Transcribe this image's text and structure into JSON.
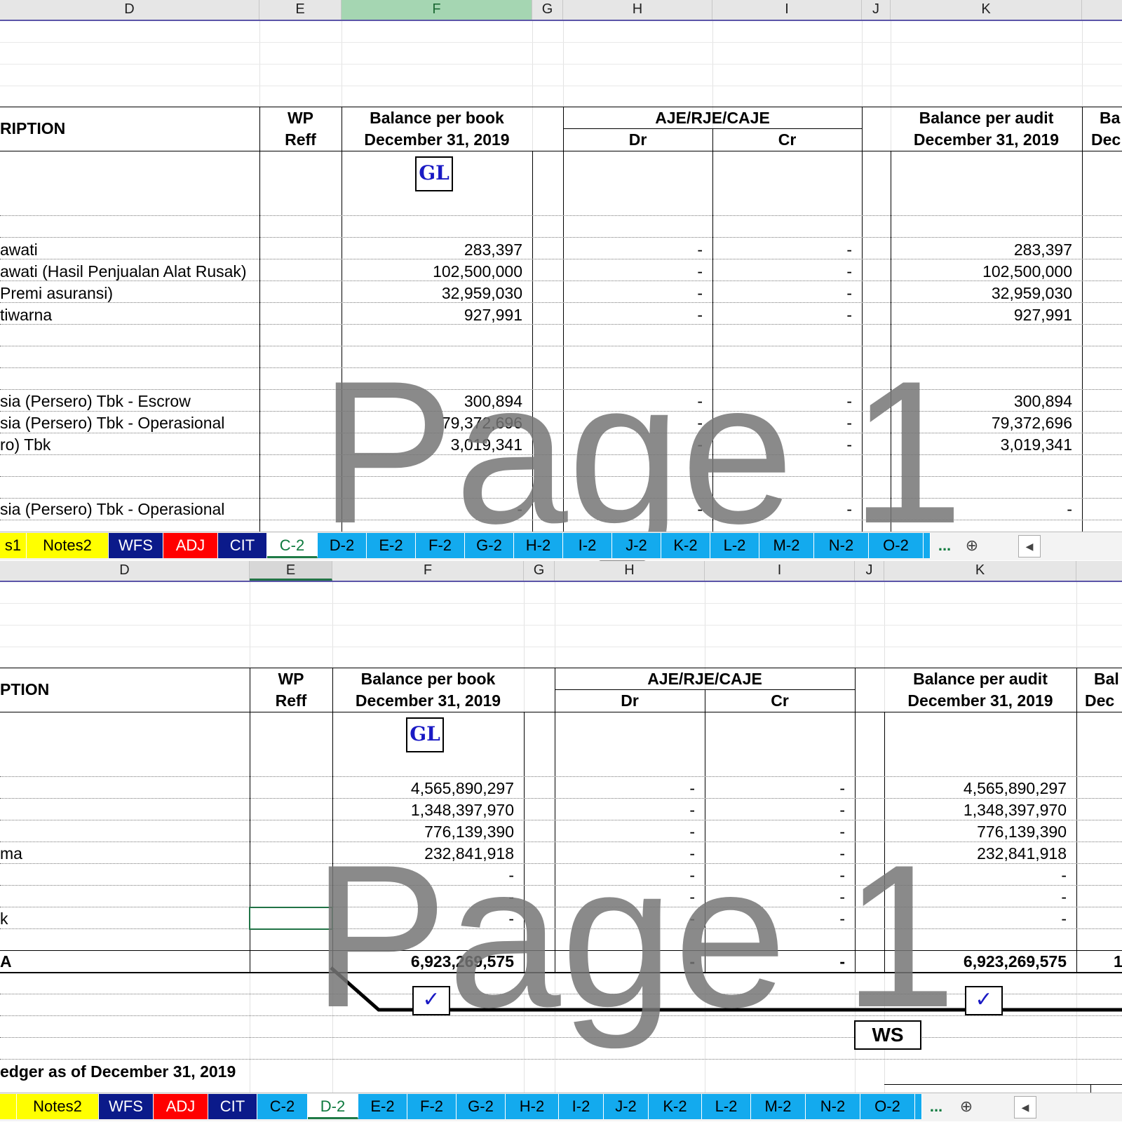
{
  "pane1": {
    "columns": [
      "D",
      "E",
      "F",
      "G",
      "H",
      "I",
      "J",
      "K"
    ],
    "selected_column": "F",
    "header": {
      "description": "RIPTION",
      "wp": "WP",
      "reff": "Reff",
      "book_line1": "Balance per book",
      "book_line2": "December 31, 2019",
      "aje": "AJE/RJE/CAJE",
      "dr": "Dr",
      "cr": "Cr",
      "audit_line1": "Balance per audit",
      "audit_line2": "December 31, 2019",
      "next_line1": "Ba",
      "next_line2": "Dec"
    },
    "gl_label": "GL",
    "rows": [
      {
        "desc": "awati",
        "book": "283,397",
        "dr": "-",
        "cr": "-",
        "audit": "283,397"
      },
      {
        "desc": "awati (Hasil Penjualan Alat Rusak)",
        "book": "102,500,000",
        "dr": "-",
        "cr": "-",
        "audit": "102,500,000"
      },
      {
        "desc": "Premi asuransi)",
        "book": "32,959,030",
        "dr": "-",
        "cr": "-",
        "audit": "32,959,030"
      },
      {
        "desc": "tiwarna",
        "book": "927,991",
        "dr": "-",
        "cr": "-",
        "audit": "927,991"
      },
      {
        "desc": "sia (Persero) Tbk - Escrow",
        "book": "300,894",
        "dr": "-",
        "cr": "-",
        "audit": "300,894"
      },
      {
        "desc": "sia (Persero) Tbk - Operasional",
        "book": "79,372,696",
        "dr": "-",
        "cr": "-",
        "audit": "79,372,696"
      },
      {
        "desc": "ro) Tbk",
        "book": "3,019,341",
        "dr": "-",
        "cr": "-",
        "audit": "3,019,341"
      },
      {
        "desc": "sia (Persero) Tbk - Operasional",
        "book": "-",
        "dr": "-",
        "cr": "-",
        "audit": "-"
      }
    ],
    "watermark": "Page 1",
    "tabs": [
      "s1",
      "Notes2",
      "WFS",
      "ADJ",
      "CIT",
      "C-2",
      "D-2",
      "E-2",
      "F-2",
      "G-2",
      "H-2",
      "I-2",
      "J-2",
      "K-2",
      "L-2",
      "M-2",
      "N-2",
      "O-2"
    ],
    "active_tab": "C-2"
  },
  "pane2": {
    "columns": [
      "D",
      "E",
      "F",
      "G",
      "H",
      "I",
      "J",
      "K"
    ],
    "selected_column": "E",
    "header": {
      "description": "PTION",
      "wp": "WP",
      "reff": "Reff",
      "book_line1": "Balance per book",
      "book_line2": "December 31, 2019",
      "aje": "AJE/RJE/CAJE",
      "dr": "Dr",
      "cr": "Cr",
      "audit_line1": "Balance per audit",
      "audit_line2": "December 31, 2019",
      "next_line1": "Bal",
      "next_line2": "Dec"
    },
    "gl_label": "GL",
    "rows": [
      {
        "desc": "",
        "book": "4,565,890,297",
        "dr": "-",
        "cr": "-",
        "audit": "4,565,890,297"
      },
      {
        "desc": "",
        "book": "1,348,397,970",
        "dr": "-",
        "cr": "-",
        "audit": "1,348,397,970"
      },
      {
        "desc": "",
        "book": "776,139,390",
        "dr": "-",
        "cr": "-",
        "audit": "776,139,390"
      },
      {
        "desc": "ma",
        "book": "232,841,918",
        "dr": "-",
        "cr": "-",
        "audit": "232,841,918"
      },
      {
        "desc": "",
        "book": "-",
        "dr": "-",
        "cr": "-",
        "audit": "-"
      },
      {
        "desc": "",
        "book": "-",
        "dr": "-",
        "cr": "-",
        "audit": "-"
      },
      {
        "desc": "k",
        "book": "-",
        "dr": "-",
        "cr": "-",
        "audit": "-"
      }
    ],
    "total": {
      "desc": "A",
      "book": "6,923,269,575",
      "dr": "-",
      "cr": "-",
      "audit": "6,923,269,575",
      "next": "1"
    },
    "tick_mark": "✓",
    "ws_label": "WS",
    "ledger_note": "edger as of December 31, 2019",
    "watermark": "Page 1",
    "tabs": [
      "",
      "Notes2",
      "WFS",
      "ADJ",
      "CIT",
      "C-2",
      "D-2",
      "E-2",
      "F-2",
      "G-2",
      "H-2",
      "I-2",
      "J-2",
      "K-2",
      "L-2",
      "M-2",
      "N-2",
      "O-2"
    ],
    "active_tab": "D-2"
  },
  "tabbar_controls": {
    "more": "...",
    "add": "⊕",
    "scroll_left": "◀"
  }
}
